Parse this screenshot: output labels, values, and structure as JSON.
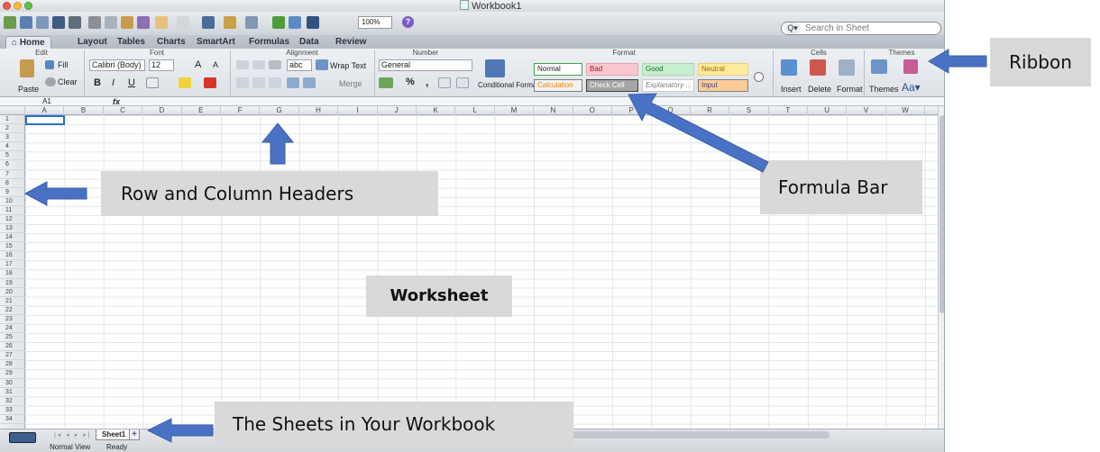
{
  "window": {
    "title": "Workbook1"
  },
  "toolbar": {
    "zoom": "100%",
    "help": "?"
  },
  "search": {
    "placeholder": "Search in Sheet",
    "mag": "Q▾"
  },
  "tabs": [
    {
      "label": "Home",
      "active": true
    },
    {
      "label": "Layout"
    },
    {
      "label": "Tables"
    },
    {
      "label": "Charts"
    },
    {
      "label": "SmartArt"
    },
    {
      "label": "Formulas"
    },
    {
      "label": "Data"
    },
    {
      "label": "Review"
    }
  ],
  "ribbon_tools": "^ ✲▾",
  "ribbon": {
    "groups": [
      "Edit",
      "Font",
      "Alignment",
      "Number",
      "Format",
      "Cells",
      "Themes"
    ],
    "edit": {
      "paste": "Paste",
      "fill": "Fill",
      "clear": "Clear"
    },
    "font": {
      "name": "Calibri (Body)",
      "size": "12",
      "bold": "B",
      "italic": "I",
      "underline": "U",
      "grow": "A",
      "shrink": "A"
    },
    "alignment": {
      "wrap": "Wrap Text",
      "merge": "Merge",
      "abc": "abc"
    },
    "number": {
      "format": "General",
      "percent": "%",
      "comma": ",",
      "cond": "Conditional Formatting",
      "cond2": "Formatting"
    },
    "styles": [
      {
        "label": "Normal",
        "bg": "#ffffff",
        "fg": "#222222",
        "border": "#3fa34d"
      },
      {
        "label": "Bad",
        "bg": "#f9c7ce",
        "fg": "#9c1d2e",
        "border": "#e3a6af"
      },
      {
        "label": "Good",
        "bg": "#c6efcf",
        "fg": "#1e6b2d",
        "border": "#a4d8ae"
      },
      {
        "label": "Neutral",
        "bg": "#feeb9c",
        "fg": "#9c6500",
        "border": "#e8cf72"
      },
      {
        "label": "Calculation",
        "bg": "#f2f2f2",
        "fg": "#fa7d00",
        "border": "#7f7f7f"
      },
      {
        "label": "Check Cell",
        "bg": "#a5a5a5",
        "fg": "#ffffff",
        "border": "#3f3f3f"
      },
      {
        "label": "Explanatory ...",
        "bg": "#ffffff",
        "fg": "#7f7f7f",
        "border": "#cccccc"
      },
      {
        "label": "Input",
        "bg": "#fecc99",
        "fg": "#3f3f76",
        "border": "#7f7f7f"
      }
    ],
    "cells": {
      "insert": "Insert",
      "delete": "Delete",
      "format": "Format"
    },
    "themes": {
      "themes": "Themes",
      "aa": "Aa▾"
    }
  },
  "formula_bar": {
    "name_box": "A1",
    "fx": "fx"
  },
  "columns": [
    "A",
    "B",
    "C",
    "D",
    "E",
    "F",
    "G",
    "H",
    "I",
    "J",
    "K",
    "L",
    "M",
    "N",
    "O",
    "P",
    "Q",
    "R",
    "S",
    "T",
    "U",
    "V",
    "W"
  ],
  "row_count": 34,
  "sheets": [
    {
      "label": "Sheet1"
    }
  ],
  "add_sheet": "+",
  "nav_arrows": "|◂ ◂ ▸ ▸|",
  "status": {
    "view": "Normal View",
    "ready": "Ready"
  },
  "callouts": {
    "ribbon": "Ribbon",
    "headers": "Row and Column Headers",
    "formula": "Formula Bar",
    "worksheet": "Worksheet",
    "sheets": "The Sheets in Your Workbook"
  },
  "colors": {
    "accent": "#4a72c4",
    "callout_bg": "#d9d9d9",
    "selection": "#2a6fcf"
  }
}
